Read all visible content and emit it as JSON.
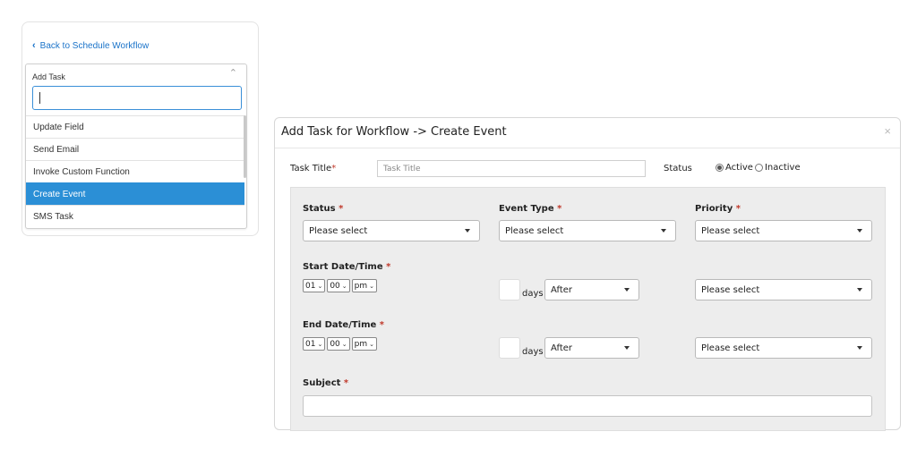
{
  "left_panel": {
    "back_link": "Back to Schedule Workflow",
    "dropdown": {
      "title": "Add Task",
      "search_value": "",
      "items": [
        {
          "label": "Update Field",
          "selected": false
        },
        {
          "label": "Send Email",
          "selected": false
        },
        {
          "label": "Invoke Custom Function",
          "selected": false
        },
        {
          "label": "Create Event",
          "selected": true
        },
        {
          "label": "SMS Task",
          "selected": false
        }
      ]
    }
  },
  "modal": {
    "title": "Add Task for Workflow -> Create Event",
    "close": "×",
    "task_title_label": "Task Title",
    "task_title_placeholder": "Task Title",
    "status_label": "Status",
    "status_options": [
      "Active",
      "Inactive"
    ],
    "status_selected": "Active",
    "form": {
      "status_label": "Status",
      "event_type_label": "Event Type",
      "priority_label": "Priority",
      "please_select": "Please select",
      "start_label": "Start Date/Time",
      "end_label": "End Date/Time",
      "subject_label": "Subject",
      "time": {
        "hour": "01",
        "minute": "00",
        "ampm": "pm"
      },
      "days_label": "days",
      "after_option": "After",
      "required_mark": "*"
    }
  },
  "colors": {
    "accent": "#2b8fd6",
    "link": "#1a73c9",
    "required": "#c0392b",
    "panel_bg": "#ededed"
  }
}
